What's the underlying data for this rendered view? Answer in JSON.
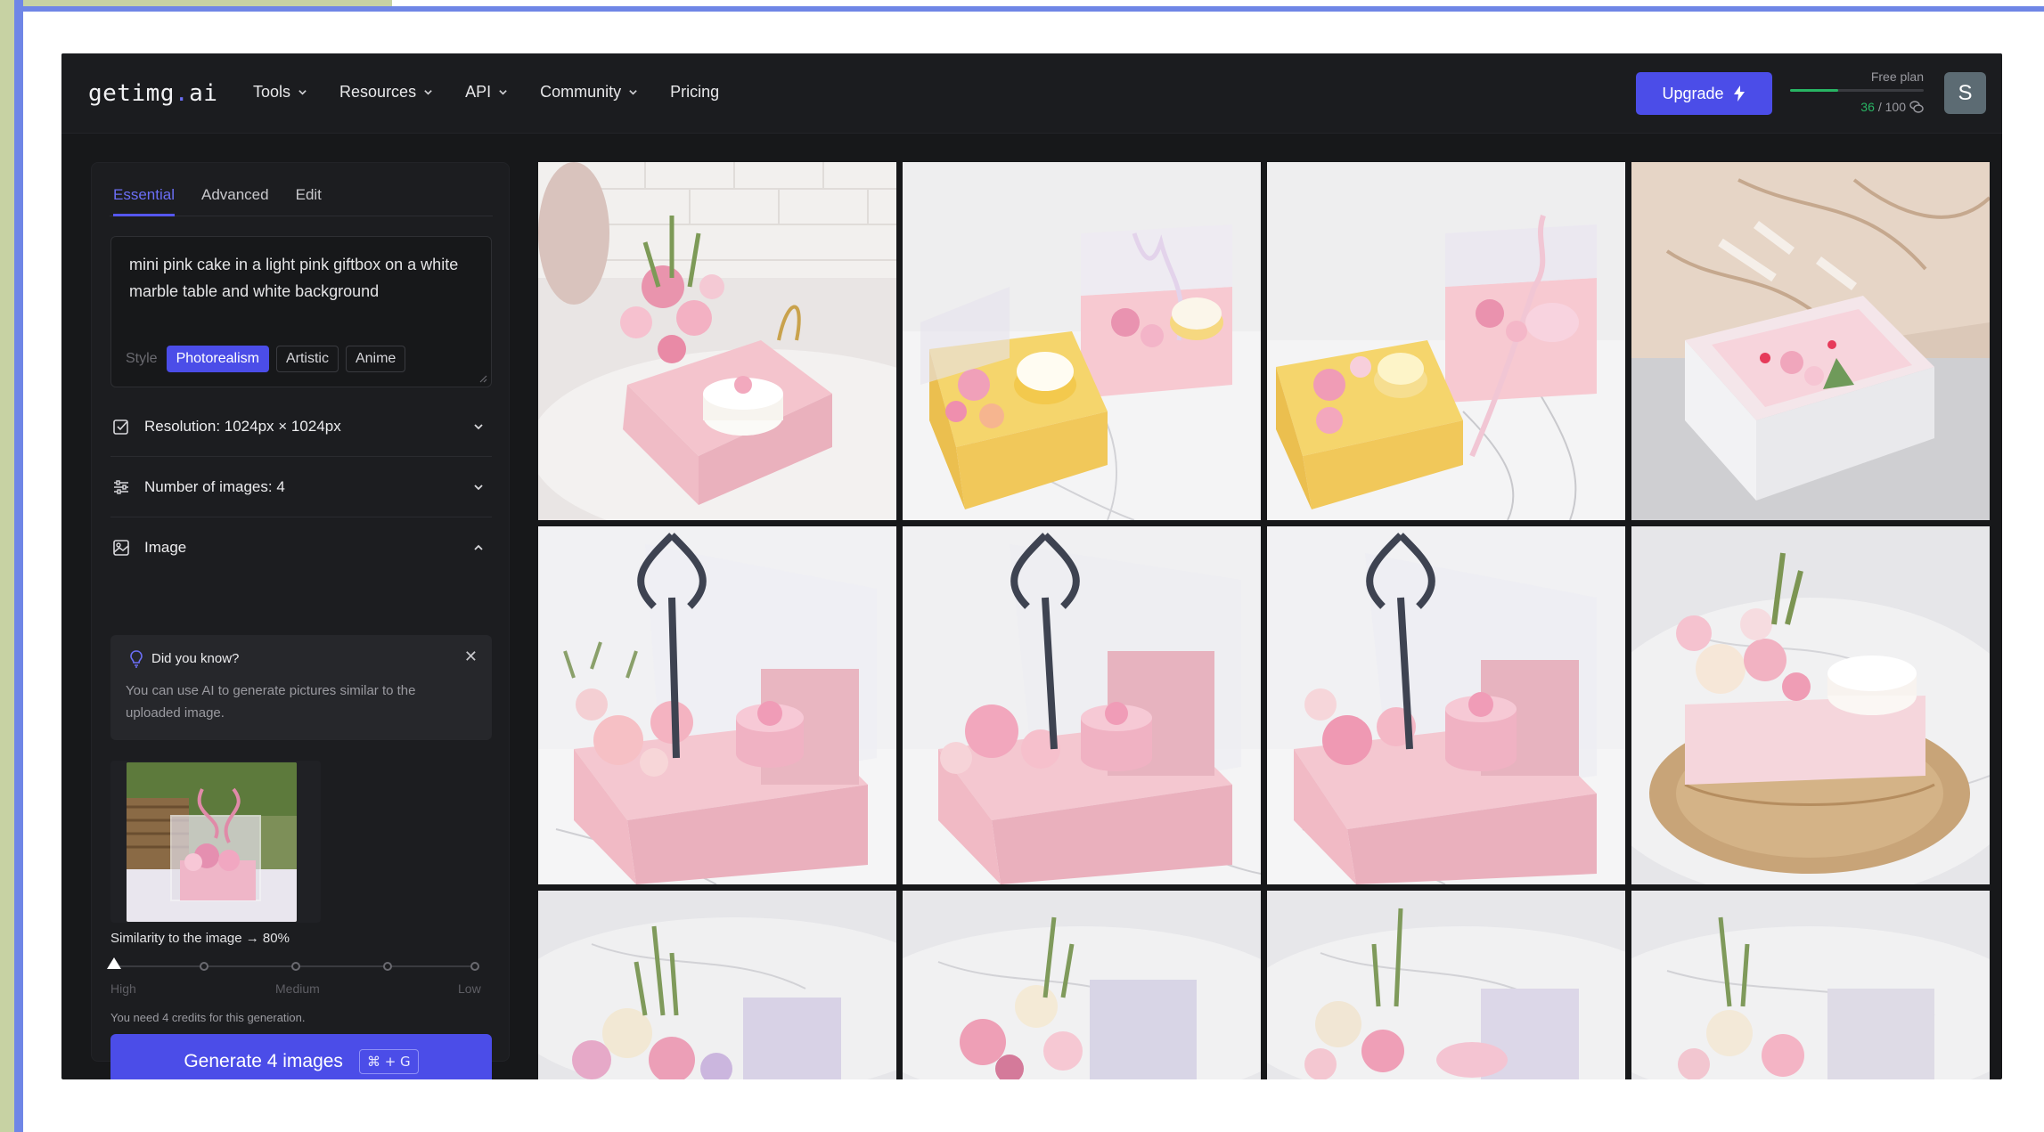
{
  "app": {
    "logo": "getimg.ai",
    "logo_main": "getimg",
    "logo_dot": ".",
    "logo_tld": "ai"
  },
  "nav": {
    "items": [
      {
        "label": "Tools",
        "icon": "chevron-down-icon"
      },
      {
        "label": "Resources",
        "icon": "chevron-down-icon"
      },
      {
        "label": "API",
        "icon": "chevron-down-icon"
      },
      {
        "label": "Community",
        "icon": "chevron-down-icon"
      },
      {
        "label": "Pricing"
      }
    ]
  },
  "header": {
    "upgrade_label": "Upgrade",
    "upgrade_icon": "lightning-icon",
    "plan_label": "Free plan",
    "credits_used": "36",
    "credits_total": "/ 100",
    "credits_fraction": 0.36,
    "avatar_letter": "S"
  },
  "tabs": [
    {
      "label": "Essential",
      "active": true
    },
    {
      "label": "Advanced",
      "active": false
    },
    {
      "label": "Edit",
      "active": false
    }
  ],
  "prompt": {
    "text": "mini pink cake in a light pink giftbox  on a white marble table and white background",
    "style_label": "Style",
    "styles": [
      {
        "label": "Photorealism",
        "active": true
      },
      {
        "label": "Artistic",
        "active": false
      },
      {
        "label": "Anime",
        "active": false
      }
    ]
  },
  "settings": {
    "resolution": "Resolution: 1024px × 1024px",
    "num_images": "Number of images: 4",
    "image": "Image"
  },
  "tip": {
    "title": "Did you know?",
    "body": "You can use AI to generate pictures similar to the uploaded image.",
    "close": "✕"
  },
  "similarity": {
    "label": "Similarity to the image → 80%",
    "value_percent": 80,
    "high": "High",
    "medium": "Medium",
    "low": "Low"
  },
  "generate": {
    "credits_note": "You need 4 credits for this generation.",
    "button_label": "Generate 4 images",
    "shortcut": "⌘ + G"
  },
  "colors": {
    "accent": "#4b4de8",
    "background": "#17181a",
    "panel": "#1c1d20",
    "success": "#28b463"
  },
  "gallery": {
    "images": [
      "pink-cake-giftbox-flowers",
      "yellow-pink-boxes-cupcakes",
      "yellow-pink-boxes-cupcakes-2",
      "white-box-cake-marble-wall",
      "pink-box-black-ribbon-1",
      "pink-box-black-ribbon-2",
      "pink-box-black-ribbon-3",
      "flowers-cake-wicker-mat",
      "flowers-cake-marble-1",
      "flowers-cake-marble-2",
      "flowers-cake-marble-3",
      "flowers-cake-marble-4"
    ]
  }
}
